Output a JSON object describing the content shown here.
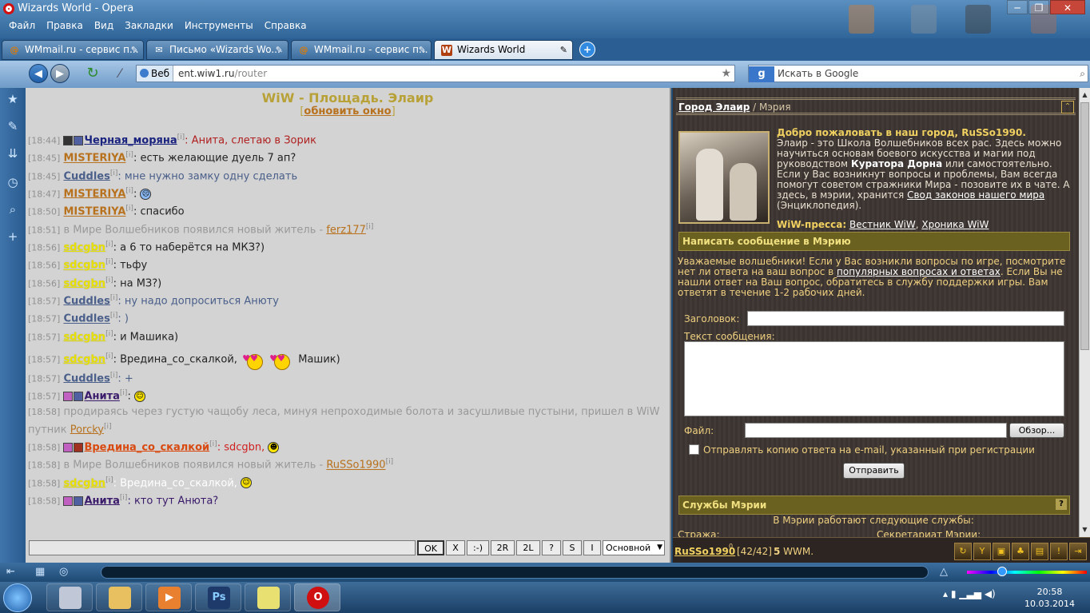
{
  "window": {
    "title": "Wizards World - Opera",
    "controls": [
      "─",
      "❐",
      "✕"
    ]
  },
  "menu": [
    "Файл",
    "Правка",
    "Вид",
    "Закладки",
    "Инструменты",
    "Справка"
  ],
  "tabs": [
    {
      "label": "WMmail.ru - сервис п...",
      "icon": "@",
      "active": false
    },
    {
      "label": "Письмо «Wizards Wo...",
      "icon": "✉",
      "active": false
    },
    {
      "label": "WMmail.ru - сервис п...",
      "icon": "@",
      "active": false
    },
    {
      "label": "Wizards World",
      "icon": "W",
      "active": true
    }
  ],
  "address": {
    "badge": "Веб",
    "url_host": "ent.wiw1.ru",
    "url_path": "/router"
  },
  "search": {
    "engine": "g",
    "placeholder": "Искать в Google"
  },
  "chat": {
    "title": "WiW - Площадь. Элаир",
    "refresh_prefix": "[",
    "refresh": "обновить окно",
    "refresh_suffix": "]",
    "inf": "[i]",
    "messages": [
      {
        "time": "[18:44]",
        "nick": "Черная_моряна",
        "text": ": Анита, слетаю в Зорик",
        "nick_color": "#1a237e",
        "text_color": "#b02020"
      },
      {
        "time": "[18:45]",
        "nick": "MISTERIYA",
        "text": ": есть желающие дуель 7 ап?",
        "nick_color": "#b8721e",
        "text_color": "#222"
      },
      {
        "time": "[18:45]",
        "nick": "Cuddles",
        "text": ": мне нужно замку одну сделать",
        "nick_color": "#4a5f8a",
        "text_color": "#4a5f8a"
      },
      {
        "time": "[18:47]",
        "nick": "MISTERIYA",
        "text": ":",
        "nick_color": "#b8721e",
        "text_color": "#222"
      },
      {
        "time": "[18:50]",
        "nick": "MISTERIYA",
        "text": ": спасибо",
        "nick_color": "#b8721e",
        "text_color": "#222"
      },
      {
        "time": "[18:51]",
        "system": "в Мире Волшебников появился новый житель - ",
        "link": "ferz177"
      },
      {
        "time": "[18:56]",
        "nick": "sdcgbn",
        "text": ": а 6 то наберётся на МКЗ?)",
        "nick_color": "#e8e000",
        "text_color": "#222"
      },
      {
        "time": "[18:56]",
        "nick": "sdcgbn",
        "text": ": тьфу",
        "nick_color": "#e8e000",
        "text_color": "#222"
      },
      {
        "time": "[18:56]",
        "nick": "sdcgbn",
        "text": ": на МЗ?)",
        "nick_color": "#e8e000",
        "text_color": "#222"
      },
      {
        "time": "[18:57]",
        "nick": "Cuddles",
        "text": ": ну надо допроситься Анюту",
        "nick_color": "#4a5f8a",
        "text_color": "#4a5f8a"
      },
      {
        "time": "[18:57]",
        "nick": "Cuddles",
        "text": ": )",
        "nick_color": "#4a5f8a",
        "text_color": "#4a5f8a"
      },
      {
        "time": "[18:57]",
        "nick": "sdcgbn",
        "text": ": и Машика)",
        "nick_color": "#e8e000",
        "text_color": "#222"
      },
      {
        "time": "[18:57]",
        "nick": "sdcgbn",
        "text": ": Вредина_со_скалкой,",
        "text2": "Машик)",
        "nick_color": "#e8e000",
        "text_color": "#222"
      },
      {
        "time": "[18:57]",
        "nick": "Cuddles",
        "text": ": +",
        "nick_color": "#4a5f8a",
        "text_color": "#4a5f8a"
      },
      {
        "time": "[18:57]",
        "nick": "Анита",
        "text": ":",
        "nick_color": "#3a1a6a",
        "text_color": "#222"
      },
      {
        "time": "[18:58]",
        "system": "продираясь через густую чащобу леса, минуя непроходимые болота и засушливые пустыни, пришел в WiW",
        "system2": "путник ",
        "link": "Porcky"
      },
      {
        "time": "[18:58]",
        "nick": "Вредина_со_скалкой",
        "text": ": sdcgbn,",
        "nick_color": "#d84a10",
        "text_color": "#d02020"
      },
      {
        "time": "[18:58]",
        "system": "в Мире Волшебников появился новый житель - ",
        "link": "RuSSo1990"
      },
      {
        "time": "[18:58]",
        "nick": "sdcgbn",
        "text": ": Вредина_со_скалкой,",
        "nick_color": "#e8e000",
        "text_color": "#ffffff"
      },
      {
        "time": "[18:58]",
        "nick": "Анита",
        "text": ": кто тут Анюта?",
        "nick_color": "#3a1a6a",
        "text_color": "#3a1a6a"
      }
    ],
    "buttons": [
      "OK",
      "X",
      ":-)",
      "2R",
      "2L",
      "?",
      "S",
      "I"
    ],
    "channel": "Основной"
  },
  "city": {
    "crumb_link": "Город Элаир",
    "crumb_sep": " / ",
    "crumb_sub": "Мэрия",
    "up_icon": "⌃",
    "welcome_title": "Добро пожаловать в наш город, RuSSo1990.",
    "welcome_1": "Элаир - это Школа Волшебников всех рас. Здесь можно научиться основам боевого искусства и магии под руководством ",
    "curator": "Куратора Дорна",
    "welcome_2": " или самостоятельно. Если у Вас возникнут вопросы и проблемы, Вам всегда помогут советом стражники Мира - позовите их в чате. А здесь, в мэрии, хранится ",
    "laws_link": "Свод законов нашего мира",
    "welcome_3": " (Энциклопедия).",
    "press_label": "WiW-пресса:",
    "press_1": "Вестник WiW",
    "press_sep": ", ",
    "press_2": "Хроника WiW",
    "write_title": "Написать сообщение в Мэрию",
    "notice_1": "Уважаемые волшебники! Если у Вас возникли вопросы по игре, посмотрите нет ли ответа на ваш вопрос в ",
    "notice_link": "популярных вопросах и ответах",
    "notice_2": ". Если Вы не нашли ответ на Ваш вопрос, обратитесь в службу поддержки игры. Вам ответят в течение 1-2 рабочих дней.",
    "subject_label": "Заголовок:",
    "text_label": "Текст сообщения:",
    "file_label": "Файл:",
    "browse": "Обзор...",
    "copy_label": "Отправлять копию ответа на e-mail, указанный при регистрации",
    "send": "Отправить",
    "services_title": "Службы Мэрии",
    "services_q": "?",
    "services_intro": "В Мэрии работают следующие службы:",
    "svc_a": "Стража:",
    "svc_b": "Секретариат Мэрии:"
  },
  "status": {
    "user": "RuSSo1990",
    "level": "0",
    "hp": "[42/42]",
    "money_value": "5",
    "money_unit": " WWM."
  },
  "clock": {
    "time": "20:58",
    "date": "10.03.2014"
  },
  "colors": {
    "chat_bg": "#d3d3d3",
    "city_bg": "#3a3330",
    "accent_gold": "#f0d060"
  }
}
